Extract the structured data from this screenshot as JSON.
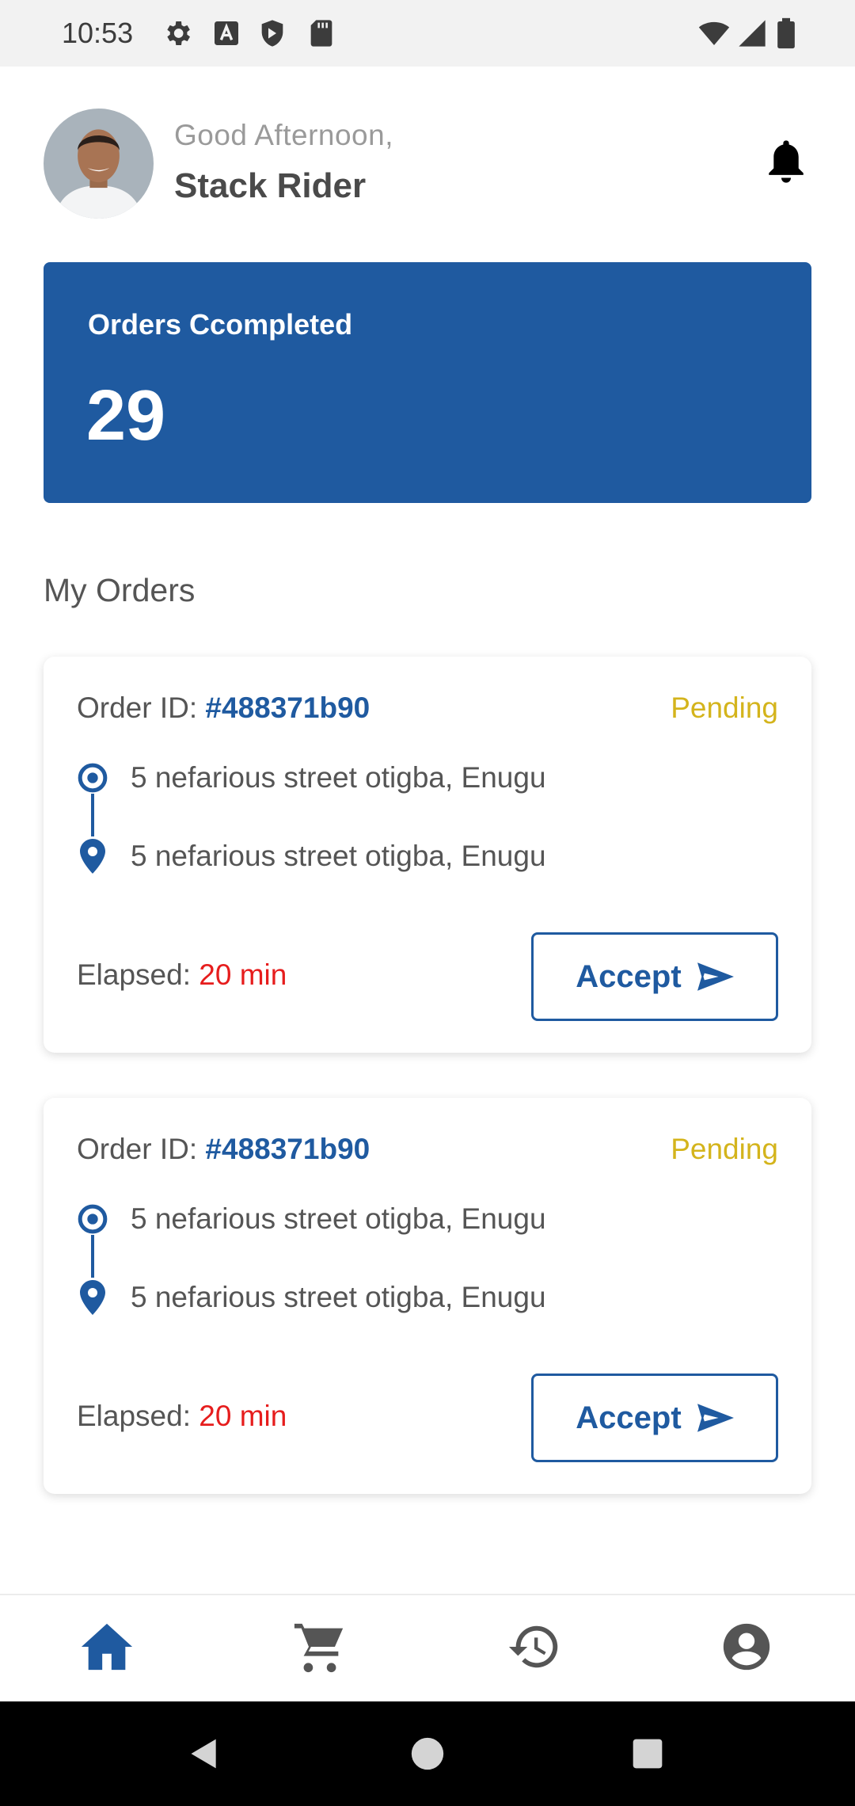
{
  "status_bar": {
    "time": "10:53",
    "left_icons": [
      "settings-icon",
      "a-square-icon",
      "shield-icon",
      "sd-card-icon"
    ],
    "right_icons": [
      "wifi-icon",
      "signal-icon",
      "battery-icon"
    ]
  },
  "header": {
    "greeting": "Good Afternoon,",
    "username": "Stack Rider",
    "notification_icon": "bell-icon"
  },
  "stats": {
    "label": "Orders Ccompleted",
    "value": "29"
  },
  "section_title": "My Orders",
  "orders": [
    {
      "id_label": "Order ID:",
      "id_value": "#488371b90",
      "status": "Pending",
      "from": "5 nefarious street otigba, Enugu",
      "to": "5 nefarious street otigba, Enugu",
      "elapsed_label": "Elapsed:",
      "elapsed_value": "20 min",
      "accept_label": "Accept"
    },
    {
      "id_label": "Order ID:",
      "id_value": "#488371b90",
      "status": "Pending",
      "from": "5 nefarious street otigba, Enugu",
      "to": "5 nefarious street otigba, Enugu",
      "elapsed_label": "Elapsed:",
      "elapsed_value": "20 min",
      "accept_label": "Accept"
    }
  ],
  "bottom_nav": [
    {
      "icon": "home-icon",
      "active": true
    },
    {
      "icon": "cart-icon",
      "active": false
    },
    {
      "icon": "history-icon",
      "active": false
    },
    {
      "icon": "profile-icon",
      "active": false
    }
  ],
  "colors": {
    "primary": "#1f5aa0",
    "pending": "#d4b41c",
    "elapsed": "#e61d1d",
    "inactive_icon": "#555555"
  }
}
